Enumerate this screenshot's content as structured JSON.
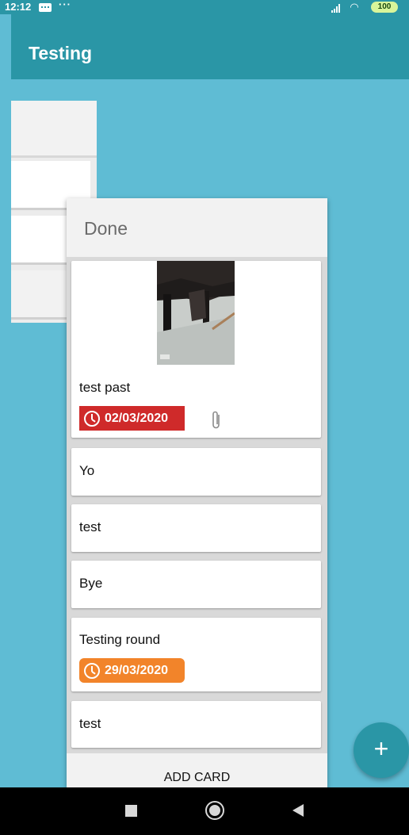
{
  "status_bar": {
    "time": "12:12",
    "dots": "···",
    "wifi": "◠",
    "battery": "100"
  },
  "app_bar": {
    "title": "Testing"
  },
  "done_list": {
    "title": "Done",
    "cards": [
      {
        "title": "test past",
        "has_image": true,
        "due_date": "02/03/2020",
        "due_color": "#cf2a2a",
        "has_attachment": true
      },
      {
        "title": "Yo"
      },
      {
        "title": "test"
      },
      {
        "title": "Bye"
      },
      {
        "title": "Testing round",
        "due_date": "29/03/2020",
        "due_color": "#f2842a"
      },
      {
        "title": "test"
      }
    ],
    "add_card_label": "ADD CARD"
  },
  "fab": {
    "label": "+"
  },
  "colors": {
    "primary": "#2a96a6",
    "background": "#5fbcd4",
    "due_overdue": "#cf2a2a",
    "due_soon": "#f2842a"
  }
}
